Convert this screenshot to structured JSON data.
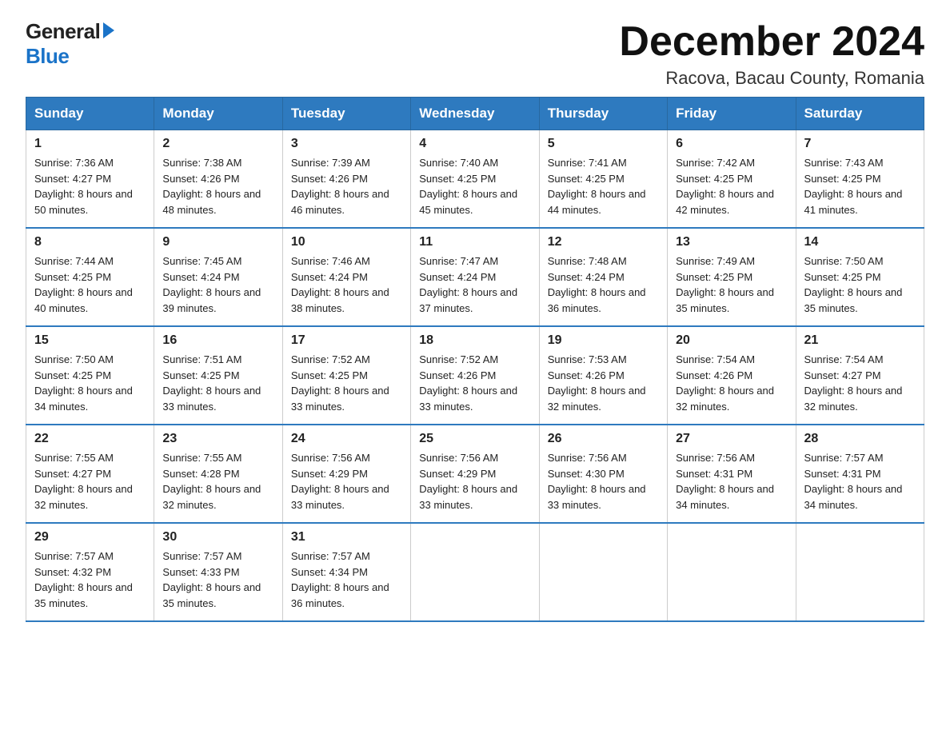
{
  "logo": {
    "general": "General",
    "blue": "Blue"
  },
  "title": "December 2024",
  "location": "Racova, Bacau County, Romania",
  "headers": [
    "Sunday",
    "Monday",
    "Tuesday",
    "Wednesday",
    "Thursday",
    "Friday",
    "Saturday"
  ],
  "weeks": [
    [
      {
        "day": "1",
        "sunrise": "7:36 AM",
        "sunset": "4:27 PM",
        "daylight": "8 hours and 50 minutes."
      },
      {
        "day": "2",
        "sunrise": "7:38 AM",
        "sunset": "4:26 PM",
        "daylight": "8 hours and 48 minutes."
      },
      {
        "day": "3",
        "sunrise": "7:39 AM",
        "sunset": "4:26 PM",
        "daylight": "8 hours and 46 minutes."
      },
      {
        "day": "4",
        "sunrise": "7:40 AM",
        "sunset": "4:25 PM",
        "daylight": "8 hours and 45 minutes."
      },
      {
        "day": "5",
        "sunrise": "7:41 AM",
        "sunset": "4:25 PM",
        "daylight": "8 hours and 44 minutes."
      },
      {
        "day": "6",
        "sunrise": "7:42 AM",
        "sunset": "4:25 PM",
        "daylight": "8 hours and 42 minutes."
      },
      {
        "day": "7",
        "sunrise": "7:43 AM",
        "sunset": "4:25 PM",
        "daylight": "8 hours and 41 minutes."
      }
    ],
    [
      {
        "day": "8",
        "sunrise": "7:44 AM",
        "sunset": "4:25 PM",
        "daylight": "8 hours and 40 minutes."
      },
      {
        "day": "9",
        "sunrise": "7:45 AM",
        "sunset": "4:24 PM",
        "daylight": "8 hours and 39 minutes."
      },
      {
        "day": "10",
        "sunrise": "7:46 AM",
        "sunset": "4:24 PM",
        "daylight": "8 hours and 38 minutes."
      },
      {
        "day": "11",
        "sunrise": "7:47 AM",
        "sunset": "4:24 PM",
        "daylight": "8 hours and 37 minutes."
      },
      {
        "day": "12",
        "sunrise": "7:48 AM",
        "sunset": "4:24 PM",
        "daylight": "8 hours and 36 minutes."
      },
      {
        "day": "13",
        "sunrise": "7:49 AM",
        "sunset": "4:25 PM",
        "daylight": "8 hours and 35 minutes."
      },
      {
        "day": "14",
        "sunrise": "7:50 AM",
        "sunset": "4:25 PM",
        "daylight": "8 hours and 35 minutes."
      }
    ],
    [
      {
        "day": "15",
        "sunrise": "7:50 AM",
        "sunset": "4:25 PM",
        "daylight": "8 hours and 34 minutes."
      },
      {
        "day": "16",
        "sunrise": "7:51 AM",
        "sunset": "4:25 PM",
        "daylight": "8 hours and 33 minutes."
      },
      {
        "day": "17",
        "sunrise": "7:52 AM",
        "sunset": "4:25 PM",
        "daylight": "8 hours and 33 minutes."
      },
      {
        "day": "18",
        "sunrise": "7:52 AM",
        "sunset": "4:26 PM",
        "daylight": "8 hours and 33 minutes."
      },
      {
        "day": "19",
        "sunrise": "7:53 AM",
        "sunset": "4:26 PM",
        "daylight": "8 hours and 32 minutes."
      },
      {
        "day": "20",
        "sunrise": "7:54 AM",
        "sunset": "4:26 PM",
        "daylight": "8 hours and 32 minutes."
      },
      {
        "day": "21",
        "sunrise": "7:54 AM",
        "sunset": "4:27 PM",
        "daylight": "8 hours and 32 minutes."
      }
    ],
    [
      {
        "day": "22",
        "sunrise": "7:55 AM",
        "sunset": "4:27 PM",
        "daylight": "8 hours and 32 minutes."
      },
      {
        "day": "23",
        "sunrise": "7:55 AM",
        "sunset": "4:28 PM",
        "daylight": "8 hours and 32 minutes."
      },
      {
        "day": "24",
        "sunrise": "7:56 AM",
        "sunset": "4:29 PM",
        "daylight": "8 hours and 33 minutes."
      },
      {
        "day": "25",
        "sunrise": "7:56 AM",
        "sunset": "4:29 PM",
        "daylight": "8 hours and 33 minutes."
      },
      {
        "day": "26",
        "sunrise": "7:56 AM",
        "sunset": "4:30 PM",
        "daylight": "8 hours and 33 minutes."
      },
      {
        "day": "27",
        "sunrise": "7:56 AM",
        "sunset": "4:31 PM",
        "daylight": "8 hours and 34 minutes."
      },
      {
        "day": "28",
        "sunrise": "7:57 AM",
        "sunset": "4:31 PM",
        "daylight": "8 hours and 34 minutes."
      }
    ],
    [
      {
        "day": "29",
        "sunrise": "7:57 AM",
        "sunset": "4:32 PM",
        "daylight": "8 hours and 35 minutes."
      },
      {
        "day": "30",
        "sunrise": "7:57 AM",
        "sunset": "4:33 PM",
        "daylight": "8 hours and 35 minutes."
      },
      {
        "day": "31",
        "sunrise": "7:57 AM",
        "sunset": "4:34 PM",
        "daylight": "8 hours and 36 minutes."
      },
      null,
      null,
      null,
      null
    ]
  ],
  "labels": {
    "sunrise": "Sunrise:",
    "sunset": "Sunset:",
    "daylight": "Daylight:"
  }
}
